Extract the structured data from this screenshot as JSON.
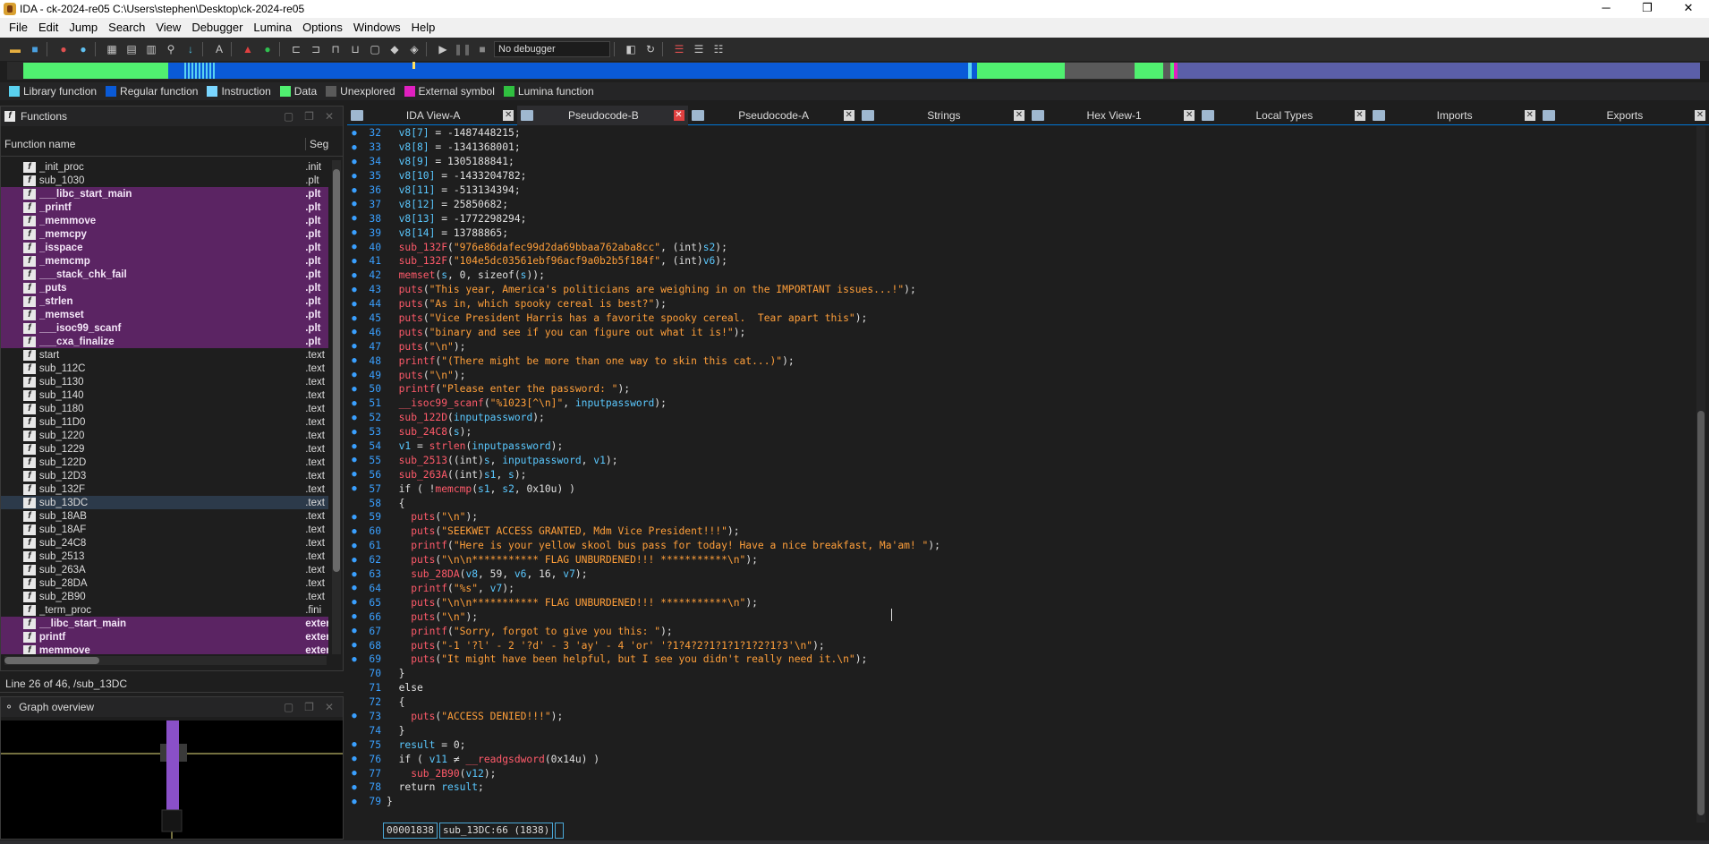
{
  "window": {
    "title": "IDA - ck-2024-re05 C:\\Users\\stephen\\Desktop\\ck-2024-re05",
    "minimize": "─",
    "maximize": "❐",
    "close": "✕"
  },
  "menu": [
    "File",
    "Edit",
    "Jump",
    "Search",
    "View",
    "Debugger",
    "Lumina",
    "Options",
    "Windows",
    "Help"
  ],
  "toolbar": {
    "debugger_select": "No debugger"
  },
  "colors": {
    "library_function": "#5ad2f0",
    "regular_function": "#0a5ad7",
    "instruction": "#7ad6ff",
    "data": "#50f070",
    "unexplored": "#5a5a5a",
    "external_symbol": "#e020c0",
    "lumina_function": "#30c040"
  },
  "legend": [
    "Library function",
    "Regular function",
    "Instruction",
    "Data",
    "Unexplored",
    "External symbol",
    "Lumina function"
  ],
  "functions_panel": {
    "title": "Functions",
    "col_name": "Function name",
    "col_seg": "Segment",
    "rows": [
      {
        "name": "_init_proc",
        "seg": ".init",
        "lib": false
      },
      {
        "name": "sub_1030",
        "seg": ".plt",
        "lib": false
      },
      {
        "name": "___libc_start_main",
        "seg": ".plt",
        "lib": true
      },
      {
        "name": "_printf",
        "seg": ".plt",
        "lib": true
      },
      {
        "name": "_memmove",
        "seg": ".plt",
        "lib": true
      },
      {
        "name": "_memcpy",
        "seg": ".plt",
        "lib": true
      },
      {
        "name": "_isspace",
        "seg": ".plt",
        "lib": true
      },
      {
        "name": "_memcmp",
        "seg": ".plt",
        "lib": true
      },
      {
        "name": "___stack_chk_fail",
        "seg": ".plt",
        "lib": true
      },
      {
        "name": "_puts",
        "seg": ".plt",
        "lib": true
      },
      {
        "name": "_strlen",
        "seg": ".plt",
        "lib": true
      },
      {
        "name": "_memset",
        "seg": ".plt",
        "lib": true
      },
      {
        "name": "___isoc99_scanf",
        "seg": ".plt",
        "lib": true
      },
      {
        "name": "___cxa_finalize",
        "seg": ".plt",
        "lib": true
      },
      {
        "name": "start",
        "seg": ".text",
        "lib": false
      },
      {
        "name": "sub_112C",
        "seg": ".text",
        "lib": false
      },
      {
        "name": "sub_1130",
        "seg": ".text",
        "lib": false
      },
      {
        "name": "sub_1140",
        "seg": ".text",
        "lib": false
      },
      {
        "name": "sub_1180",
        "seg": ".text",
        "lib": false
      },
      {
        "name": "sub_11D0",
        "seg": ".text",
        "lib": false
      },
      {
        "name": "sub_1220",
        "seg": ".text",
        "lib": false
      },
      {
        "name": "sub_1229",
        "seg": ".text",
        "lib": false
      },
      {
        "name": "sub_122D",
        "seg": ".text",
        "lib": false
      },
      {
        "name": "sub_12D3",
        "seg": ".text",
        "lib": false
      },
      {
        "name": "sub_132F",
        "seg": ".text",
        "lib": false
      },
      {
        "name": "sub_13DC",
        "seg": ".text",
        "lib": false,
        "sel": true
      },
      {
        "name": "sub_18AB",
        "seg": ".text",
        "lib": false
      },
      {
        "name": "sub_18AF",
        "seg": ".text",
        "lib": false
      },
      {
        "name": "sub_24C8",
        "seg": ".text",
        "lib": false
      },
      {
        "name": "sub_2513",
        "seg": ".text",
        "lib": false
      },
      {
        "name": "sub_263A",
        "seg": ".text",
        "lib": false
      },
      {
        "name": "sub_28DA",
        "seg": ".text",
        "lib": false
      },
      {
        "name": "sub_2B90",
        "seg": ".text",
        "lib": false
      },
      {
        "name": "_term_proc",
        "seg": ".fini",
        "lib": false
      },
      {
        "name": "__libc_start_main",
        "seg": "extern",
        "lib": true
      },
      {
        "name": "printf",
        "seg": "extern",
        "lib": true
      },
      {
        "name": "memmove",
        "seg": "extern",
        "lib": true
      }
    ]
  },
  "line_info": "Line 26 of 46, /sub_13DC",
  "graph_overview": {
    "title": "Graph overview"
  },
  "tabs": [
    {
      "label": "IDA View-A",
      "active": false
    },
    {
      "label": "Pseudocode-B",
      "active": true
    },
    {
      "label": "Pseudocode-A",
      "active": false
    },
    {
      "label": "Strings",
      "active": false
    },
    {
      "label": "Hex View-1",
      "active": false
    },
    {
      "label": "Local Types",
      "active": false
    },
    {
      "label": "Imports",
      "active": false
    },
    {
      "label": "Exports",
      "active": false
    }
  ],
  "code_lines": [
    {
      "n": "32",
      "dot": true,
      "segs": [
        [
          "var",
          "  v8[7]"
        ],
        [
          "kw",
          " = -1487448215;"
        ]
      ]
    },
    {
      "n": "33",
      "dot": true,
      "segs": [
        [
          "var",
          "  v8[8]"
        ],
        [
          "kw",
          " = -1341368001;"
        ]
      ]
    },
    {
      "n": "34",
      "dot": true,
      "segs": [
        [
          "var",
          "  v8[9]"
        ],
        [
          "kw",
          " = 1305188841;"
        ]
      ]
    },
    {
      "n": "35",
      "dot": true,
      "segs": [
        [
          "var",
          "  v8[10]"
        ],
        [
          "kw",
          " = -1433204782;"
        ]
      ]
    },
    {
      "n": "36",
      "dot": true,
      "segs": [
        [
          "var",
          "  v8[11]"
        ],
        [
          "kw",
          " = -513134394;"
        ]
      ]
    },
    {
      "n": "37",
      "dot": true,
      "segs": [
        [
          "var",
          "  v8[12]"
        ],
        [
          "kw",
          " = 25850682;"
        ]
      ]
    },
    {
      "n": "38",
      "dot": true,
      "segs": [
        [
          "var",
          "  v8[13]"
        ],
        [
          "kw",
          " = -1772298294;"
        ]
      ]
    },
    {
      "n": "39",
      "dot": true,
      "segs": [
        [
          "var",
          "  v8[14]"
        ],
        [
          "kw",
          " = 13788865;"
        ]
      ]
    },
    {
      "n": "40",
      "dot": true,
      "segs": [
        [
          "fn",
          "  sub_132F"
        ],
        [
          "kw",
          "("
        ],
        [
          "str",
          "\"976e86dafec99d2da69bbaa762aba8cc\""
        ],
        [
          "kw",
          ", (int)"
        ],
        [
          "var",
          "s2"
        ],
        [
          "kw",
          ");"
        ]
      ]
    },
    {
      "n": "41",
      "dot": true,
      "segs": [
        [
          "fn",
          "  sub_132F"
        ],
        [
          "kw",
          "("
        ],
        [
          "str",
          "\"104e5dc03561ebf96acf9a0b2b5f184f\""
        ],
        [
          "kw",
          ", (int)"
        ],
        [
          "var",
          "v6"
        ],
        [
          "kw",
          ");"
        ]
      ]
    },
    {
      "n": "42",
      "dot": true,
      "segs": [
        [
          "fn",
          "  memset"
        ],
        [
          "kw",
          "("
        ],
        [
          "var",
          "s"
        ],
        [
          "kw",
          ", 0, sizeof("
        ],
        [
          "var",
          "s"
        ],
        [
          "kw",
          "));"
        ]
      ]
    },
    {
      "n": "43",
      "dot": true,
      "segs": [
        [
          "fn",
          "  puts"
        ],
        [
          "kw",
          "("
        ],
        [
          "str",
          "\"This year, America's politicians are weighing in on the IMPORTANT issues...!\""
        ],
        [
          "kw",
          ");"
        ]
      ]
    },
    {
      "n": "44",
      "dot": true,
      "segs": [
        [
          "fn",
          "  puts"
        ],
        [
          "kw",
          "("
        ],
        [
          "str",
          "\"As in, which spooky cereal is best?\""
        ],
        [
          "kw",
          ");"
        ]
      ]
    },
    {
      "n": "45",
      "dot": true,
      "segs": [
        [
          "fn",
          "  puts"
        ],
        [
          "kw",
          "("
        ],
        [
          "str",
          "\"Vice President Harris has a favorite spooky cereal.  Tear apart this\""
        ],
        [
          "kw",
          ");"
        ]
      ]
    },
    {
      "n": "46",
      "dot": true,
      "segs": [
        [
          "fn",
          "  puts"
        ],
        [
          "kw",
          "("
        ],
        [
          "str",
          "\"binary and see if you can figure out what it is!\""
        ],
        [
          "kw",
          ");"
        ]
      ]
    },
    {
      "n": "47",
      "dot": true,
      "segs": [
        [
          "fn",
          "  puts"
        ],
        [
          "kw",
          "("
        ],
        [
          "str",
          "\"\\n\""
        ],
        [
          "kw",
          ");"
        ]
      ]
    },
    {
      "n": "48",
      "dot": true,
      "segs": [
        [
          "fn",
          "  printf"
        ],
        [
          "kw",
          "("
        ],
        [
          "str",
          "\"(There might be more than one way to skin this cat...)\""
        ],
        [
          "kw",
          ");"
        ]
      ]
    },
    {
      "n": "49",
      "dot": true,
      "segs": [
        [
          "fn",
          "  puts"
        ],
        [
          "kw",
          "("
        ],
        [
          "str",
          "\"\\n\""
        ],
        [
          "kw",
          ");"
        ]
      ]
    },
    {
      "n": "50",
      "dot": true,
      "segs": [
        [
          "fn",
          "  printf"
        ],
        [
          "kw",
          "("
        ],
        [
          "str",
          "\"Please enter the password: \""
        ],
        [
          "kw",
          ");"
        ]
      ]
    },
    {
      "n": "51",
      "dot": true,
      "segs": [
        [
          "fn",
          "  __isoc99_scanf"
        ],
        [
          "kw",
          "("
        ],
        [
          "str",
          "\"%1023[^\\n]\""
        ],
        [
          "kw",
          ", "
        ],
        [
          "var",
          "inputpassword"
        ],
        [
          "kw",
          ");"
        ]
      ]
    },
    {
      "n": "52",
      "dot": true,
      "segs": [
        [
          "fn",
          "  sub_122D"
        ],
        [
          "kw",
          "("
        ],
        [
          "var",
          "inputpassword"
        ],
        [
          "kw",
          ");"
        ]
      ]
    },
    {
      "n": "53",
      "dot": true,
      "segs": [
        [
          "fn",
          "  sub_24C8"
        ],
        [
          "kw",
          "("
        ],
        [
          "var",
          "s"
        ],
        [
          "kw",
          ");"
        ]
      ]
    },
    {
      "n": "54",
      "dot": true,
      "segs": [
        [
          "var",
          "  v1"
        ],
        [
          "kw",
          " = "
        ],
        [
          "fn",
          "strlen"
        ],
        [
          "kw",
          "("
        ],
        [
          "var",
          "inputpassword"
        ],
        [
          "kw",
          ");"
        ]
      ]
    },
    {
      "n": "55",
      "dot": true,
      "segs": [
        [
          "fn",
          "  sub_2513"
        ],
        [
          "kw",
          "((int)"
        ],
        [
          "var",
          "s"
        ],
        [
          "kw",
          ", "
        ],
        [
          "var",
          "inputpassword"
        ],
        [
          "kw",
          ", "
        ],
        [
          "var",
          "v1"
        ],
        [
          "kw",
          ");"
        ]
      ]
    },
    {
      "n": "56",
      "dot": true,
      "segs": [
        [
          "fn",
          "  sub_263A"
        ],
        [
          "kw",
          "((int)"
        ],
        [
          "var",
          "s1"
        ],
        [
          "kw",
          ", "
        ],
        [
          "var",
          "s"
        ],
        [
          "kw",
          ");"
        ]
      ]
    },
    {
      "n": "57",
      "dot": true,
      "segs": [
        [
          "kw",
          "  if ( !"
        ],
        [
          "fn",
          "memcmp"
        ],
        [
          "kw",
          "("
        ],
        [
          "var",
          "s1"
        ],
        [
          "kw",
          ", "
        ],
        [
          "var",
          "s2"
        ],
        [
          "kw",
          ", 0x10u) )"
        ]
      ]
    },
    {
      "n": "58",
      "dot": false,
      "segs": [
        [
          "kw",
          "  {"
        ]
      ]
    },
    {
      "n": "59",
      "dot": true,
      "segs": [
        [
          "fn",
          "    puts"
        ],
        [
          "kw",
          "("
        ],
        [
          "str",
          "\"\\n\""
        ],
        [
          "kw",
          ");"
        ]
      ]
    },
    {
      "n": "60",
      "dot": true,
      "segs": [
        [
          "fn",
          "    puts"
        ],
        [
          "kw",
          "("
        ],
        [
          "str",
          "\"SEEKWET ACCESS GRANTED, Mdm Vice President!!!\""
        ],
        [
          "kw",
          ");"
        ]
      ]
    },
    {
      "n": "61",
      "dot": true,
      "segs": [
        [
          "fn",
          "    printf"
        ],
        [
          "kw",
          "("
        ],
        [
          "str",
          "\"Here is your yellow skool bus pass for today! Have a nice breakfast, Ma'am! \""
        ],
        [
          "kw",
          ");"
        ]
      ]
    },
    {
      "n": "62",
      "dot": true,
      "segs": [
        [
          "fn",
          "    puts"
        ],
        [
          "kw",
          "("
        ],
        [
          "str",
          "\"\\n\\n*********** FLAG UNBURDENED!!! ***********\\n\""
        ],
        [
          "kw",
          ");"
        ]
      ]
    },
    {
      "n": "63",
      "dot": true,
      "segs": [
        [
          "fn",
          "    sub_28DA"
        ],
        [
          "kw",
          "("
        ],
        [
          "var",
          "v8"
        ],
        [
          "kw",
          ", 59, "
        ],
        [
          "var",
          "v6"
        ],
        [
          "kw",
          ", 16, "
        ],
        [
          "var",
          "v7"
        ],
        [
          "kw",
          ");"
        ]
      ]
    },
    {
      "n": "64",
      "dot": true,
      "segs": [
        [
          "fn",
          "    printf"
        ],
        [
          "kw",
          "("
        ],
        [
          "str",
          "\"%s\""
        ],
        [
          "kw",
          ", "
        ],
        [
          "var",
          "v7"
        ],
        [
          "kw",
          ");"
        ]
      ]
    },
    {
      "n": "65",
      "dot": true,
      "segs": [
        [
          "fn",
          "    puts"
        ],
        [
          "kw",
          "("
        ],
        [
          "str",
          "\"\\n\\n*********** FLAG UNBURDENED!!! ***********\\n\""
        ],
        [
          "kw",
          ");"
        ]
      ]
    },
    {
      "n": "66",
      "dot": true,
      "segs": [
        [
          "fn",
          "    puts"
        ],
        [
          "kw",
          "("
        ],
        [
          "str",
          "\"\\n\""
        ],
        [
          "kw",
          ");"
        ]
      ]
    },
    {
      "n": "67",
      "dot": true,
      "segs": [
        [
          "fn",
          "    printf"
        ],
        [
          "kw",
          "("
        ],
        [
          "str",
          "\"Sorry, forgot to give you this: \""
        ],
        [
          "kw",
          ");"
        ]
      ]
    },
    {
      "n": "68",
      "dot": true,
      "segs": [
        [
          "fn",
          "    puts"
        ],
        [
          "kw",
          "("
        ],
        [
          "str",
          "\"-1 '?l' - 2 '?d' - 3 'ay' - 4 'or' '?1?4?2?1?1?1?1?2?1?3'\\n\""
        ],
        [
          "kw",
          ");"
        ]
      ]
    },
    {
      "n": "69",
      "dot": true,
      "segs": [
        [
          "fn",
          "    puts"
        ],
        [
          "kw",
          "("
        ],
        [
          "str",
          "\"It might have been helpful, but I see you didn't really need it.\\n\""
        ],
        [
          "kw",
          ");"
        ]
      ]
    },
    {
      "n": "70",
      "dot": false,
      "segs": [
        [
          "kw",
          "  }"
        ]
      ]
    },
    {
      "n": "71",
      "dot": false,
      "segs": [
        [
          "kw",
          "  else"
        ]
      ]
    },
    {
      "n": "72",
      "dot": false,
      "segs": [
        [
          "kw",
          "  {"
        ]
      ]
    },
    {
      "n": "73",
      "dot": true,
      "segs": [
        [
          "fn",
          "    puts"
        ],
        [
          "kw",
          "("
        ],
        [
          "str",
          "\"ACCESS DENIED!!!\""
        ],
        [
          "kw",
          ");"
        ]
      ]
    },
    {
      "n": "74",
      "dot": false,
      "segs": [
        [
          "kw",
          "  }"
        ]
      ]
    },
    {
      "n": "75",
      "dot": true,
      "segs": [
        [
          "var",
          "  result"
        ],
        [
          "kw",
          " = 0;"
        ]
      ]
    },
    {
      "n": "76",
      "dot": true,
      "segs": [
        [
          "kw",
          "  if ( "
        ],
        [
          "var",
          "v11"
        ],
        [
          "kw",
          " ≠ "
        ],
        [
          "fn",
          "__readgsdword"
        ],
        [
          "kw",
          "(0x14u) )"
        ]
      ]
    },
    {
      "n": "77",
      "dot": true,
      "segs": [
        [
          "fn",
          "    sub_2B90"
        ],
        [
          "kw",
          "("
        ],
        [
          "var",
          "v12"
        ],
        [
          "kw",
          ");"
        ]
      ]
    },
    {
      "n": "78",
      "dot": true,
      "segs": [
        [
          "kw",
          "  return "
        ],
        [
          "var",
          "result"
        ],
        [
          "kw",
          ";"
        ]
      ]
    },
    {
      "n": "79",
      "dot": true,
      "segs": [
        [
          "kw",
          "}"
        ]
      ]
    }
  ],
  "code_status": {
    "address": "00001838",
    "location": "sub_13DC:66 (1838)"
  }
}
